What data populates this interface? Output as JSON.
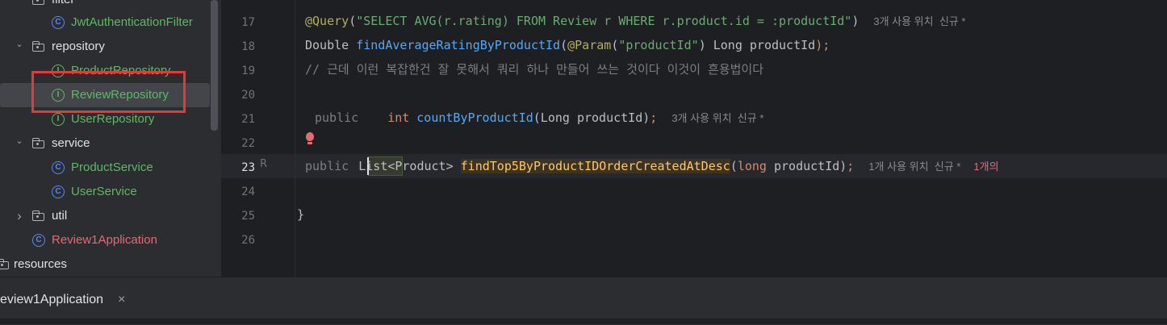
{
  "sidebar": {
    "items": [
      {
        "label": "filter",
        "kind": "folder",
        "color": "#dfe1e5"
      },
      {
        "label": "JwtAuthenticationFilter",
        "kind": "class",
        "color": "#5fb865"
      },
      {
        "label": "repository",
        "kind": "folder",
        "color": "#dfe1e5"
      },
      {
        "label": "ProductRepository",
        "kind": "interface",
        "color": "#5fb865"
      },
      {
        "label": "ReviewRepository",
        "kind": "interface",
        "color": "#5fb865"
      },
      {
        "label": "UserRepository",
        "kind": "interface",
        "color": "#5fb865"
      },
      {
        "label": "service",
        "kind": "folder",
        "color": "#dfe1e5"
      },
      {
        "label": "ProductService",
        "kind": "class",
        "color": "#5fb865"
      },
      {
        "label": "UserService",
        "kind": "class",
        "color": "#5fb865"
      },
      {
        "label": "util",
        "kind": "folder",
        "color": "#dfe1e5"
      },
      {
        "label": "Review1Application",
        "kind": "spring-app",
        "color": "#e06c75"
      },
      {
        "label": "resources",
        "kind": "folder",
        "color": "#dfe1e5"
      }
    ],
    "class_icon_letter": "C",
    "interface_icon_letter": "I",
    "chevron_down": "⌄",
    "chevron_right": "›"
  },
  "editor": {
    "line_numbers": [
      "17",
      "18",
      "19",
      "20",
      "21",
      "22",
      "23",
      "24",
      "25",
      "26"
    ],
    "current_line": "23",
    "line17": {
      "annotation": "@Query",
      "paren_open": "(",
      "query": "\"SELECT AVG(r.rating) FROM Review r WHERE r.product.id = :productId\"",
      "paren_close": ")",
      "hint": "3개 사용 위치  신규 *"
    },
    "line18": {
      "type": "Double ",
      "method": "findAverageRatingByProductId",
      "paren_open": "(",
      "param_ann": "@Param",
      "param_str_open": "(",
      "param_str": "\"productId\"",
      "param_rest": ") Long productId",
      "close": ");"
    },
    "line19": {
      "comment": "// 근데 이런 복잡한건 잘 못해서 쿼리 하나 만들어 쓰는 것이다 이것이 흔용법이다"
    },
    "line21": {
      "modifier": "public",
      "type": "int",
      "method": "countByProductId",
      "params": "(Long productId)",
      "semi": ";",
      "hint": "3개 사용 위치  신규 *"
    },
    "line23": {
      "modifier": "public ",
      "type": "List",
      "generic": "<Product> ",
      "method": "findTop5ByProductIDOrderCreatedAtDesc",
      "params_open": "(",
      "param_kw": "long",
      "param_name": " productId",
      "params_close": ")",
      "semi": ";",
      "hint": "1개 사용 위치  신규 *",
      "hint_error": "1개의"
    },
    "line25": {
      "text": "}"
    },
    "gutter_icon": "R"
  },
  "bottom": {
    "run_tab": "eview1Application",
    "close": "×"
  }
}
